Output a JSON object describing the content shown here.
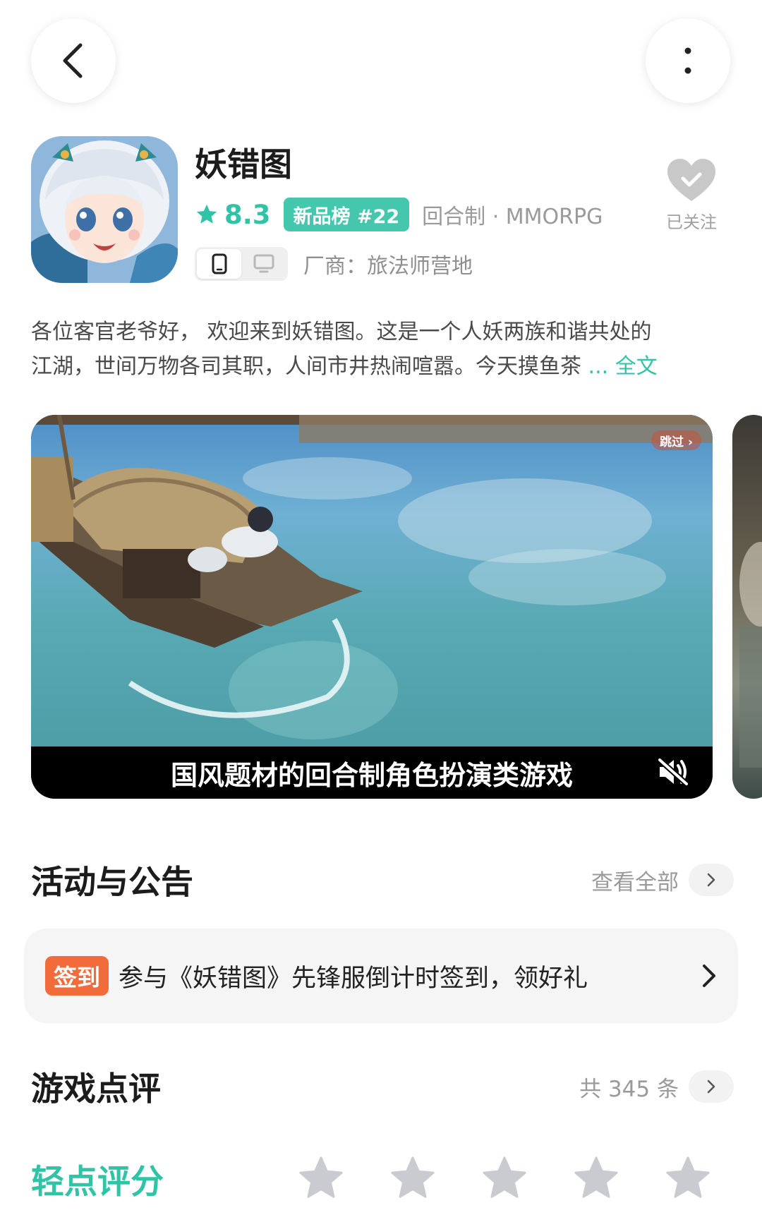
{
  "top_bar": {
    "back_icon": "chevron-left-icon",
    "more_icon": "more-vertical-icon"
  },
  "app": {
    "title": "妖错图",
    "rating": "8.3",
    "rank_badge": "新品榜 #22",
    "genre": "回合制 · MMORPG",
    "vendor": "厂商：旅法师营地",
    "follow_label": "已关注",
    "accent_color": "#31c3a6"
  },
  "description": {
    "line1": "各位客官老爷好，    欢迎来到妖错图。这是一个人妖两族和谐共处的",
    "line2": "江湖，世间万物各司其职，人间市井热闹喧嚣。今天摸鱼茶",
    "more": "... 全文"
  },
  "media": {
    "skip_label": "跳过 ›",
    "subtitle": "国风题材的回合制角色扮演类游戏"
  },
  "activities": {
    "title": "活动与公告",
    "link_label": "查看全部",
    "item_tag": "签到",
    "item_text": "参与《妖错图》先锋服倒计时签到，领好礼"
  },
  "reviews": {
    "title": "游戏点评",
    "count_label": "共 345 条"
  },
  "rate": {
    "label": "轻点评分",
    "stars_total": 5
  }
}
